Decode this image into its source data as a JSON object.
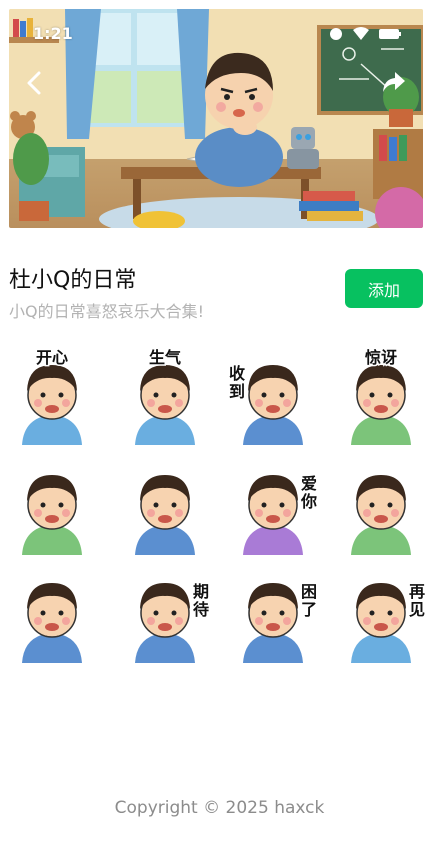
{
  "status_bar": {
    "time": "1:21"
  },
  "sticker_pack": {
    "title": "杜小Q的日常",
    "subtitle": "小Q的日常喜怒哀乐大合集!",
    "add_label": "添加"
  },
  "stickers": [
    {
      "caption": "开心",
      "mood": "happy"
    },
    {
      "caption": "生气",
      "mood": "angry"
    },
    {
      "caption": "收到",
      "mood": "salute"
    },
    {
      "caption": "惊讶",
      "mood": "surprised"
    },
    {
      "caption": "",
      "mood": "confused"
    },
    {
      "caption": "",
      "mood": "heart"
    },
    {
      "caption": "爱你",
      "mood": "love"
    },
    {
      "caption": "",
      "mood": "tongue"
    },
    {
      "caption": "",
      "mood": "thinking"
    },
    {
      "caption": "期待",
      "mood": "expecting"
    },
    {
      "caption": "困了",
      "mood": "sleepy"
    },
    {
      "caption": "再见",
      "mood": "goodbye"
    }
  ],
  "footer": {
    "copyright": "Copyright © 2025 haxck"
  },
  "colors": {
    "accent": "#07c160",
    "subtitle": "#b3b3b3",
    "footer": "#8c8c8c"
  }
}
